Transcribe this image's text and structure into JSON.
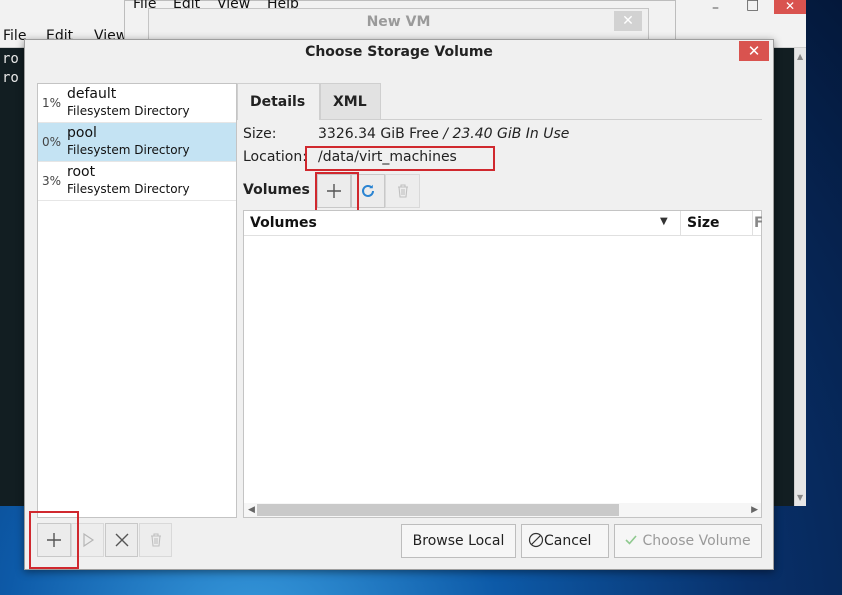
{
  "background": {
    "terminal": {
      "menu": [
        "File",
        "Edit",
        "View"
      ],
      "lines": [
        "ro",
        "ro"
      ]
    },
    "top_window": {
      "menu": [
        "File",
        "Edit",
        "View",
        "Help"
      ]
    },
    "window_controls": {
      "minimize": "–",
      "maximize": "□",
      "close": "✕"
    },
    "new_vm": {
      "title": "New VM",
      "close": "✕"
    }
  },
  "dialog": {
    "title": "Choose Storage Volume",
    "close": "✕"
  },
  "pools": [
    {
      "percent": "1%",
      "name": "default",
      "type": "Filesystem Directory",
      "selected": false
    },
    {
      "percent": "0%",
      "name": "pool",
      "type": "Filesystem Directory",
      "selected": true
    },
    {
      "percent": "3%",
      "name": "root",
      "type": "Filesystem Directory",
      "selected": false
    }
  ],
  "tabs": [
    {
      "label": "Details",
      "active": true
    },
    {
      "label": "XML",
      "active": false
    }
  ],
  "details": {
    "size_label": "Size:",
    "size_free": "3326.34 GiB Free",
    "size_sep": " / ",
    "size_in_use": "23.40 GiB In Use",
    "location_label": "Location:",
    "location_value": "/data/virt_machines"
  },
  "volumes": {
    "label": "Volumes",
    "columns": [
      "Volumes",
      "Size",
      "F"
    ],
    "rows": []
  },
  "buttons": {
    "browse_local": "Browse Local",
    "cancel": "Cancel",
    "choose_volume": "Choose Volume"
  },
  "colors": {
    "selected_row": "#c4e3f3",
    "close_button": "#d9534f",
    "highlight_box": "#d0282e"
  }
}
